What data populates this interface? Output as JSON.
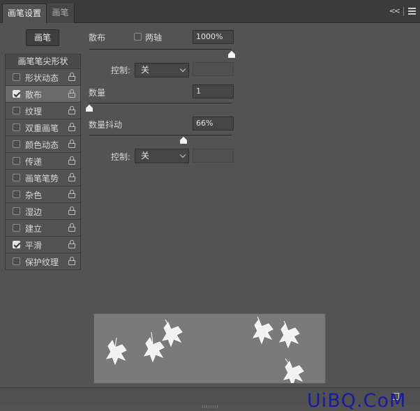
{
  "tabs": [
    {
      "label": "画笔设置",
      "active": true
    },
    {
      "label": "画笔",
      "active": false
    }
  ],
  "header": {
    "collapse_glyph": "<<",
    "menu_icon": "hamburger-menu-icon"
  },
  "brush_button": {
    "label": "画笔"
  },
  "sidebar": {
    "header": "画笔笔尖形状",
    "items": [
      {
        "label": "形状动态",
        "checked": false,
        "selected": false
      },
      {
        "label": "散布",
        "checked": true,
        "selected": true
      },
      {
        "label": "纹理",
        "checked": false,
        "selected": false
      },
      {
        "label": "双重画笔",
        "checked": false,
        "selected": false
      },
      {
        "label": "颜色动态",
        "checked": false,
        "selected": false
      },
      {
        "label": "传递",
        "checked": false,
        "selected": false
      },
      {
        "label": "画笔笔势",
        "checked": false,
        "selected": false
      },
      {
        "label": "杂色",
        "checked": false,
        "selected": false
      },
      {
        "label": "湿边",
        "checked": false,
        "selected": false
      },
      {
        "label": "建立",
        "checked": false,
        "selected": false
      },
      {
        "label": "平滑",
        "checked": true,
        "selected": false
      },
      {
        "label": "保护纹理",
        "checked": false,
        "selected": false
      }
    ]
  },
  "scatter": {
    "label": "散布",
    "both_axes_label": "两轴",
    "both_axes_checked": false,
    "value": "1000%",
    "slider_fraction": 1.0,
    "control_label": "控制:",
    "control_value": "关"
  },
  "count": {
    "label": "数量",
    "value": "1",
    "slider_fraction": 0.0
  },
  "count_jitter": {
    "label": "数量抖动",
    "value": "66%",
    "slider_fraction": 0.66,
    "control_label": "控制:",
    "control_value": "关"
  },
  "watermark": "UiBQ.CoM"
}
